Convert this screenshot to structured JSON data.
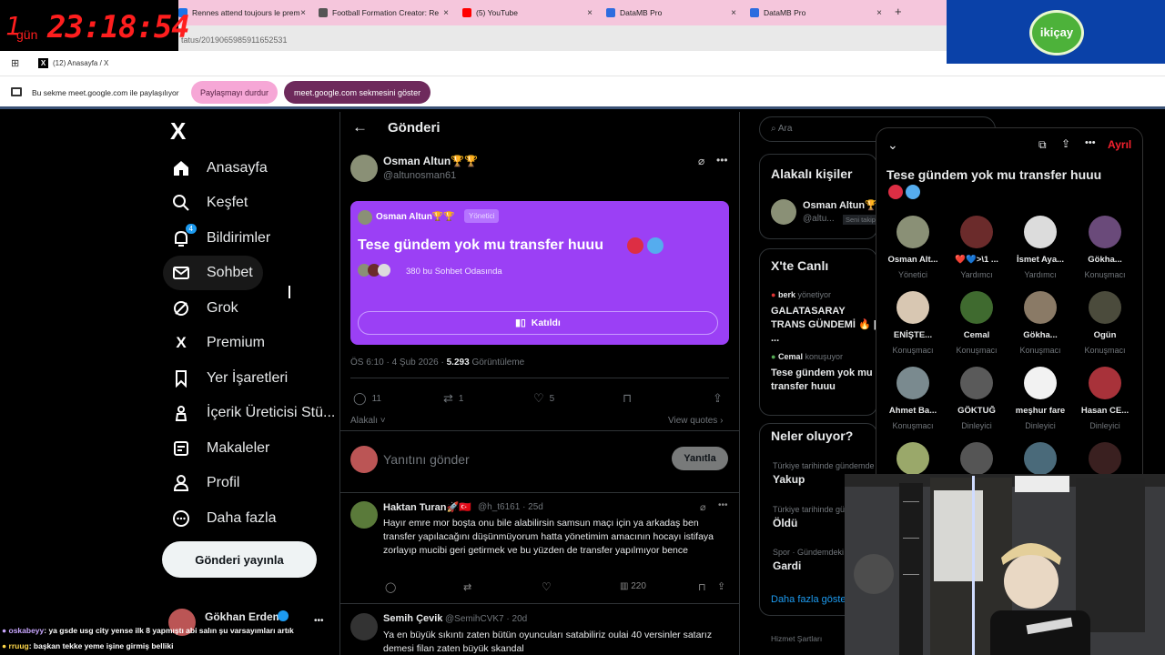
{
  "overlay": {
    "timer_days": "1",
    "timer_unit": "gün",
    "timer_clock": "23:18:54",
    "sponsor": "ikiçay"
  },
  "browser": {
    "tabs": [
      {
        "label": "Rennes attend toujours le prem",
        "color": "#1a73e8"
      },
      {
        "label": "Football Formation Creator: Re",
        "color": "#555555"
      },
      {
        "label": "(5) YouTube",
        "color": "#ff0000"
      },
      {
        "label": "DataMB Pro",
        "color": "#2d6cdf"
      },
      {
        "label": "DataMB Pro",
        "color": "#2d6cdf"
      }
    ],
    "new_tab": "+",
    "close": "×",
    "address": "tatus/2019065985911652531",
    "active_tab": "(12) Anasayfa / X",
    "share_notice": "Bu sekme meet.google.com ile paylaşılıyor",
    "stop_sharing": "Paylaşmayı durdur",
    "show_tab": "meet.google.com sekmesini göster"
  },
  "nav": {
    "logo": "X",
    "items": [
      {
        "label": "Anasayfa",
        "icon": "home-icon"
      },
      {
        "label": "Keşfet",
        "icon": "search-icon"
      },
      {
        "label": "Bildirimler",
        "icon": "bell-icon",
        "badge": "4"
      },
      {
        "label": "Sohbet",
        "icon": "mail-icon"
      },
      {
        "label": "Grok",
        "icon": "grok-icon"
      },
      {
        "label": "Premium",
        "icon": "x-icon"
      },
      {
        "label": "Yer İşaretleri",
        "icon": "bookmark-icon"
      },
      {
        "label": "İçerik Üreticisi Stü...",
        "icon": "creator-icon"
      },
      {
        "label": "Makaleler",
        "icon": "article-icon"
      },
      {
        "label": "Profil",
        "icon": "profile-icon"
      },
      {
        "label": "Daha fazla",
        "icon": "more-circle-icon"
      }
    ],
    "post_button": "Gönderi yayınla",
    "account_name": "Gökhan Erdem",
    "account_more": "•••"
  },
  "post": {
    "header": "Gönderi",
    "author": "Osman Altun🏆🏆",
    "handle": "@altunosman61",
    "space": {
      "host": "Osman Altun🏆🏆",
      "host_badge": "Yönetici",
      "title": "Tese gündem yok mu transfer huuu",
      "listeners": "380 bu Sohbet Odasında",
      "join": "Katıldı"
    },
    "time": "ÖS 6:10 · 4 Şub 2026 ·",
    "views": "5.293",
    "views_label": "Görüntüleme",
    "replies": "11",
    "reposts": "1",
    "likes": "5",
    "related": "Alakalı",
    "view_quotes": "View quotes",
    "reply_placeholder": "Yanıtını gönder",
    "reply_button": "Yanıtla"
  },
  "replies": [
    {
      "name": "Haktan Turan🚀🇹🇷",
      "handle": "@h_t6161 · 25d",
      "text": "Hayır emre mor boşta onu bile alabilirsin samsun  maçı için ya arkadaş ben transfer yapılacağını düşünmüyorum hatta yönetimim amacının hocayı istifaya zorlayıp mucibi geri getirmek ve bu yüzden de transfer yapılmıyor bence",
      "views": "220"
    },
    {
      "name": "Semih Çevik",
      "handle": "@SemihCVK7 · 20d",
      "text": "Ya en büyük sıkıntı zaten bütün oyuncuları satabiliriz oulai 40 versinler satarız demesi filan zaten büyük skandal"
    }
  ],
  "right": {
    "search_placeholder": "Ara",
    "related_people": "Alakalı kişiler",
    "person_name": "Osman Altun🏆",
    "person_handle": "@altu...",
    "person_badge": "Seni takip",
    "live_header": "X'te Canlı",
    "live": [
      {
        "user": "berk",
        "action": "yönetiyor",
        "title": "GALATASARAY TRANS GÜNDEMİ 🔥 | ..."
      },
      {
        "user": "Cemal",
        "action": "konuşuyor",
        "title": "Tese gündem yok mu transfer huuu"
      }
    ],
    "trends_header": "Neler oluyor?",
    "trends": [
      {
        "category": "Türkiye tarihinde gündemde",
        "name": "Yakup"
      },
      {
        "category": "Türkiye tarihinde gü",
        "name": "Öldü"
      },
      {
        "category": "Spor · Gündemdeki",
        "name": "Gardi"
      }
    ],
    "show_more": "Daha fazla göster",
    "footer": "Hizmet Şartları"
  },
  "spaces_panel": {
    "leave": "Ayrıl",
    "title": "Tese gündem yok mu transfer huuu",
    "people": [
      {
        "name": "Osman Alt...",
        "role": "Yönetici",
        "color": "#8a9076"
      },
      {
        "name": "❤️💙>\\1 ...",
        "role": "Yardımcı",
        "color": "#6b2b2b"
      },
      {
        "name": "İsmet Aya...",
        "role": "Yardımcı",
        "color": "#dcdcdc"
      },
      {
        "name": "Gökha...",
        "role": "Konuşmacı",
        "color": "#6a4a7a"
      },
      {
        "name": "ENİŞTE...",
        "role": "Konuşmacı",
        "color": "#d8c7b2"
      },
      {
        "name": "Cemal",
        "role": "Konuşmacı",
        "color": "#3f6a2f"
      },
      {
        "name": "Gökha...",
        "role": "Konuşmacı",
        "color": "#8a7a66"
      },
      {
        "name": "Ogün",
        "role": "Konuşmacı",
        "color": "#4b4b3c"
      },
      {
        "name": "Ahmet Ba...",
        "role": "Konuşmacı",
        "color": "#7a8a8f"
      },
      {
        "name": "GÖKTUĞ",
        "role": "Dinleyici",
        "color": "#5a5a5a"
      },
      {
        "name": "meşhur fare",
        "role": "Dinleyici",
        "color": "#f2f2f2"
      },
      {
        "name": "Hasan CE...",
        "role": "Dinleyici",
        "color": "#a8323a"
      },
      {
        "name": "",
        "role": "",
        "color": "#9aa86a"
      },
      {
        "name": "",
        "role": "",
        "color": "#555555"
      },
      {
        "name": "",
        "role": "",
        "color": "#4a6a7a"
      },
      {
        "name": "",
        "role": "",
        "color": "#3a2020"
      }
    ]
  },
  "chat": [
    {
      "user": "oskabeyy",
      "text": ": ya gsde usg city yense ilk 8 yapmıştı abi salın şu varsayımları artık",
      "color": "#c9a7ff"
    },
    {
      "user": "rruug",
      "text": ": başkan tekke yeme işine girmiş belliki",
      "color": "#ffd84a"
    }
  ]
}
